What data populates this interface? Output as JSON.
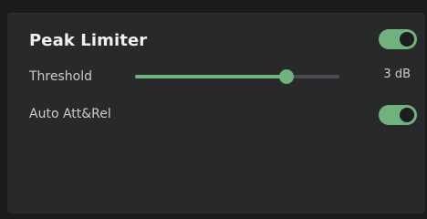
{
  "panel": {
    "title": "Peak Limiter",
    "enabled": true,
    "threshold": {
      "label": "Threshold",
      "value_text": "3 dB",
      "position_fraction": 0.74
    },
    "auto_att_rel": {
      "label": "Auto Att&Rel",
      "enabled": true
    }
  },
  "colors": {
    "accent": "#6fb27d",
    "toggle_on": "#6fb27d",
    "panel_bg": "#28292b",
    "page_bg": "#1a1b1d",
    "track": "#4a4b4e",
    "text": "#c9cccd",
    "title_text": "#eef0f0"
  }
}
